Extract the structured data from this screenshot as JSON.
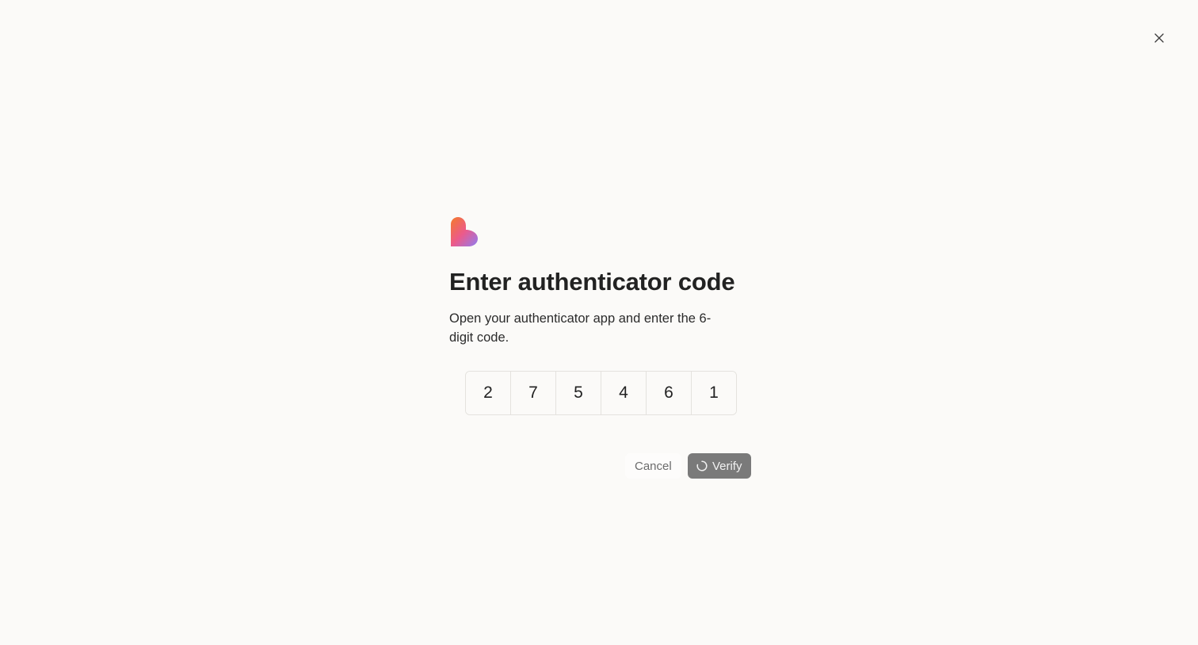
{
  "window": {
    "close_icon": "close-icon"
  },
  "brand": {
    "logo_icon": "heart-logo-icon",
    "gradient": [
      "#f26b3a",
      "#e8579a",
      "#8a7cf0"
    ]
  },
  "dialog": {
    "title": "Enter authenticator code",
    "subtitle": "Open your authenticator app and enter the 6-digit code.",
    "code_digits": [
      "2",
      "7",
      "5",
      "4",
      "6",
      "1"
    ]
  },
  "actions": {
    "cancel_label": "Cancel",
    "verify_label": "Verify",
    "verify_loading_icon": "spinner-icon",
    "verify_bg": "#7a7a7a"
  }
}
